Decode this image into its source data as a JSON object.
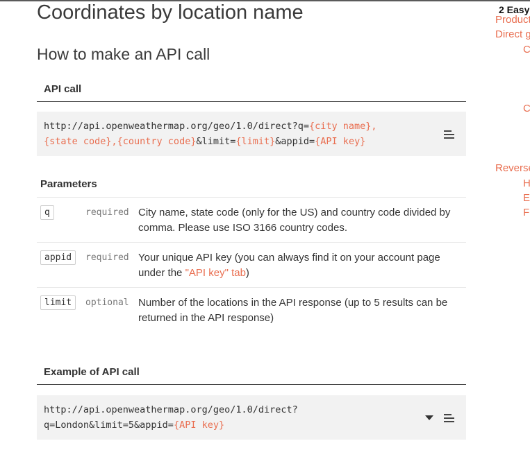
{
  "page": {
    "title": "Coordinates by location name",
    "section_title": "How to make an API call"
  },
  "api_call": {
    "heading": "API call",
    "line1_prefix": "http://api.openweathermap.org/geo/1.0/direct?q=",
    "line1_ph": "{city name},",
    "line2_ph1": "{state code},{country code}",
    "line2_mid": "&limit=",
    "line2_ph2": "{limit}",
    "line2_mid2": "&appid=",
    "line2_ph3": "{API key}",
    "menu_icon": "menu-icon"
  },
  "parameters": {
    "title": "Parameters",
    "rows": [
      {
        "name": "q",
        "requirement": "required",
        "desc_line1": "City name, state code (only for the US) and country code divided by",
        "desc_line2": "comma. Please use ISO 3166 country codes."
      },
      {
        "name": "appid",
        "requirement": "required",
        "desc_line1": "Your unique API key (you can always find it on your account page",
        "desc_line2_prefix": "under the ",
        "desc_link": "\"API key\" tab",
        "desc_line2_suffix": ")"
      },
      {
        "name": "limit",
        "requirement": "optional",
        "desc_line1": "Number of the locations in the API response (up to 5 results can be",
        "desc_line2": "returned in the API response)"
      }
    ]
  },
  "example": {
    "heading": "Example of API call",
    "line1": "http://api.openweathermap.org/geo/1.0/direct?",
    "line2_prefix": "q=London&limit=5&appid=",
    "line2_ph": "{API key}",
    "caret_icon": "caret-down-icon",
    "menu_icon": "menu-icon"
  },
  "sidebar": {
    "heading": "2 Easy",
    "items": [
      {
        "label": "Product"
      },
      {
        "label": "Direct g"
      },
      {
        "label": "C"
      },
      {
        "label": "C"
      },
      {
        "label": "Reverse"
      },
      {
        "label": "H"
      },
      {
        "label": "E"
      },
      {
        "label": "F"
      }
    ]
  },
  "colors": {
    "accent": "#e96e50",
    "code_bg": "#f2f2f2",
    "text": "#333333"
  }
}
